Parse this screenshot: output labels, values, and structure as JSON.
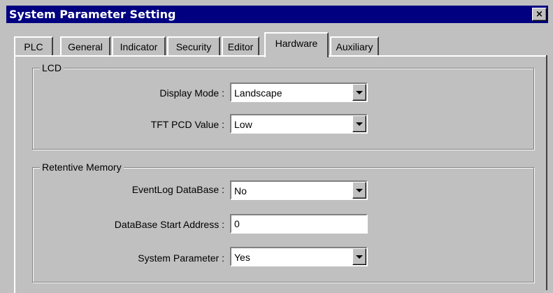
{
  "window": {
    "title": "System Parameter Setting",
    "close_label": "×"
  },
  "tabs": [
    {
      "label": "PLC",
      "active": false
    },
    {
      "label": "General",
      "active": false
    },
    {
      "label": "Indicator",
      "active": false
    },
    {
      "label": "Security",
      "active": false
    },
    {
      "label": "Editor",
      "active": false
    },
    {
      "label": "Hardware",
      "active": true
    },
    {
      "label": "Auxiliary",
      "active": false
    }
  ],
  "lcd": {
    "legend": "LCD",
    "display_mode": {
      "label": "Display Mode :",
      "value": "Landscape"
    },
    "tft_pcd": {
      "label": "TFT PCD Value :",
      "value": "Low"
    }
  },
  "retentive": {
    "legend": "Retentive Memory",
    "eventlog": {
      "label": "EventLog DataBase :",
      "value": "No"
    },
    "start_address": {
      "label": "DataBase Start Address :",
      "value": "0"
    },
    "system_parameter": {
      "label": "System Parameter :",
      "value": "Yes"
    }
  }
}
